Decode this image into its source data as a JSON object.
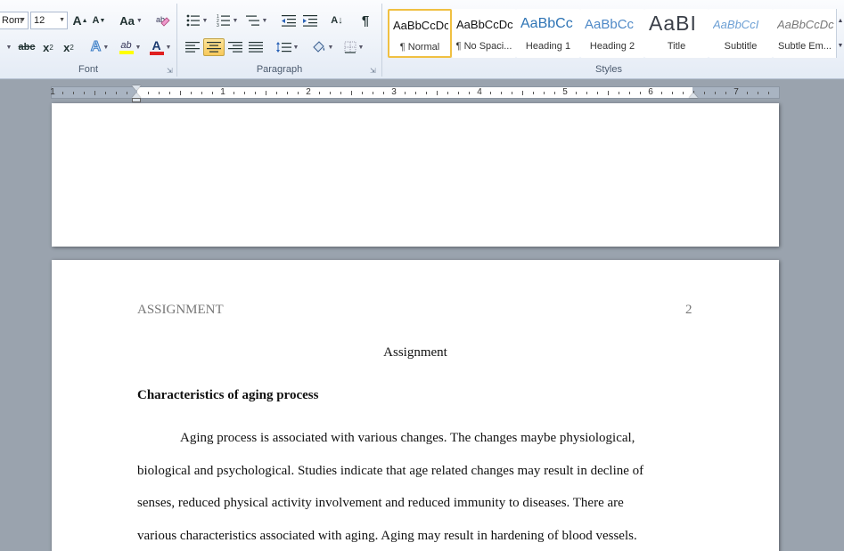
{
  "ribbon": {
    "font": {
      "label": "Font",
      "font_name": "Rom",
      "font_size": "12",
      "grow_font": "A",
      "shrink_font": "A",
      "change_case": "Aa",
      "strikethrough": "abc",
      "subscript": "x",
      "superscript": "x",
      "text_effects": "A",
      "highlight": "ab",
      "font_color": "A"
    },
    "paragraph": {
      "label": "Paragraph",
      "pilcrow": "¶",
      "sort": "A↓"
    },
    "styles": {
      "label": "Styles",
      "tiles": [
        {
          "sample": "AaBbCcDc",
          "name": "¶ Normal"
        },
        {
          "sample": "AaBbCcDc",
          "name": "¶ No Spaci..."
        },
        {
          "sample": "AaBbCc",
          "name": "Heading 1"
        },
        {
          "sample": "AaBbCc",
          "name": "Heading 2"
        },
        {
          "sample": "AaBI",
          "name": "Title"
        },
        {
          "sample": "AaBbCcI",
          "name": "Subtitle"
        },
        {
          "sample": "AaBbCcDc",
          "name": "Subtle Em..."
        }
      ]
    }
  },
  "ruler": {
    "numbers": [
      "1",
      "1",
      "2",
      "3",
      "4",
      "5",
      "6",
      "7"
    ]
  },
  "document": {
    "header_left": "ASSIGNMENT",
    "page_number": "2",
    "title": "Assignment",
    "heading": "Characteristics of aging process",
    "paragraph_lines": [
      "Aging process is associated with various changes. The changes maybe physiological,",
      "biological and psychological.  Studies indicate that age related changes may result in decline of",
      "senses, reduced physical activity involvement and reduced immunity to diseases. There are",
      "various characteristics associated with aging. Aging may result in hardening of blood vessels."
    ]
  },
  "colors": {
    "highlight_yellow": "#ffff00",
    "font_color_red": "#e02020",
    "heading_blue": "#2e74b5",
    "selected_style_border": "#f0c042"
  }
}
